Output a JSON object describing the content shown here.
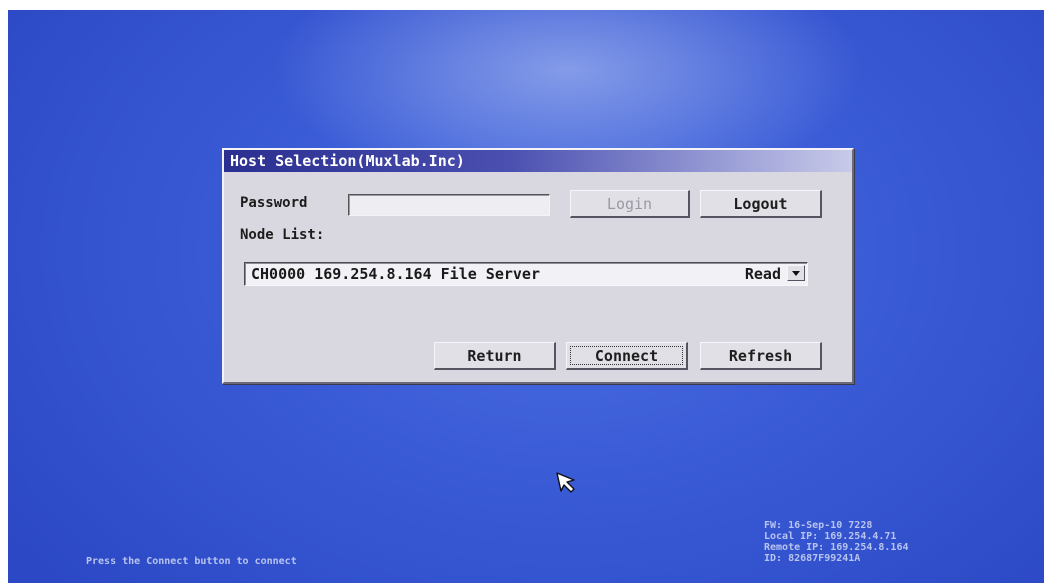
{
  "dialog": {
    "title": "Host Selection(Muxlab.Inc)",
    "password_label": "Password",
    "password_value": "",
    "login_label": "Login",
    "logout_label": "Logout",
    "node_list_label": "Node List:",
    "node_selected": {
      "text": "CH0000 169.254.8.164 File Server",
      "status": "Read"
    },
    "return_label": "Return",
    "connect_label": "Connect",
    "refresh_label": "Refresh"
  },
  "footer": {
    "hint": "Press the Connect button to connect",
    "fw": "FW: 16-Sep-10 7228",
    "local_ip": "Local IP: 169.254.4.71",
    "remote_ip": "Remote IP: 169.254.8.164",
    "id": "ID: 82687F99241A"
  },
  "colors": {
    "desktop": "#3a5bd6",
    "dialog_bg": "#d9d8e0",
    "titlebar": "#2b2f8f"
  },
  "icons": {
    "cursor": "arrow-cursor-icon",
    "dropdown": "chevron-down-icon"
  }
}
